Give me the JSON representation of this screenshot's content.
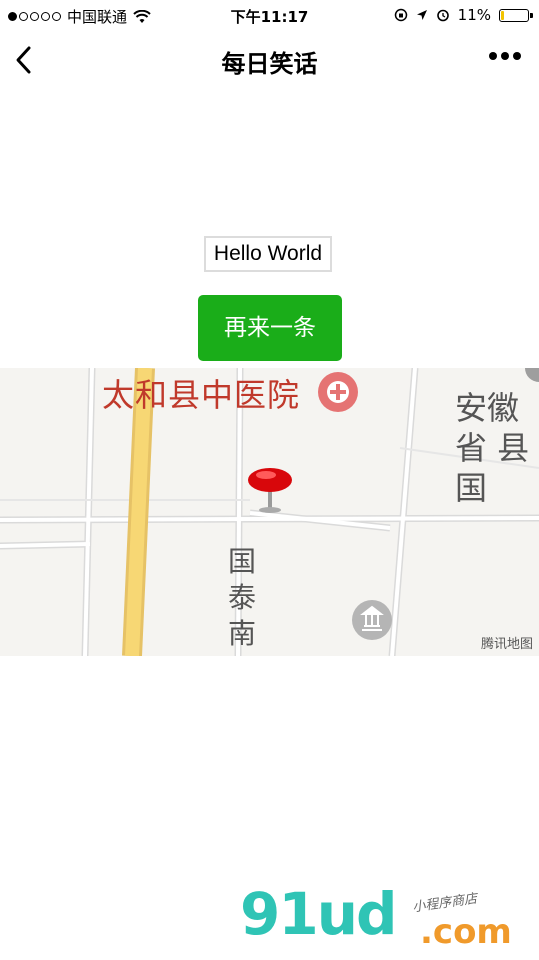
{
  "status": {
    "carrier": "中国联通",
    "time": "下午11:17",
    "battery_text": "11%",
    "battery_level": 0.11
  },
  "nav": {
    "title": "每日笑话"
  },
  "content": {
    "hello_text": "Hello World",
    "button_label": "再来一条"
  },
  "map": {
    "poi_hospital": "太和县中医院",
    "poi_anhui": "安徽省 县国",
    "road_label": "国泰南",
    "credit": "腾讯地图"
  },
  "watermark": {
    "brand": "91ud",
    "suffix": ".com",
    "tagline": "小程序商店"
  }
}
